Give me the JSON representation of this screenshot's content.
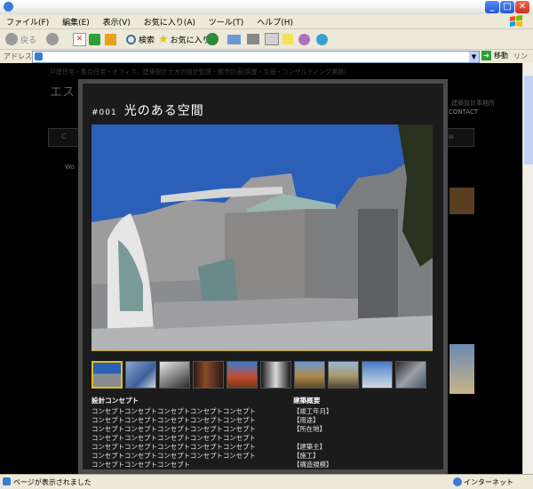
{
  "window": {
    "min_glyph": "_",
    "max_glyph": "□",
    "close_glyph": "✕"
  },
  "menu": [
    "ファイル(F)",
    "編集(E)",
    "表示(V)",
    "お気に入り(A)",
    "ツール(T)",
    "ヘルプ(H)"
  ],
  "toolbar": {
    "back": "戻る",
    "search": "検索",
    "favorites": "お気に入り"
  },
  "addressbar": {
    "label": "アドレス(D)",
    "value": "",
    "go": "移動",
    "links": "リンク"
  },
  "background_page": {
    "tagline": "戸建住宅・集合住宅・オフィス、建築設計士木の設計監理・都市計画(調査・企画・コンサルティング業務)",
    "title": "エス",
    "office": "建築設計事務所",
    "contact": "CONTACT",
    "nav_left": "C",
    "nav_right": "w",
    "sub_left": "Wo"
  },
  "lightbox": {
    "number": "#001",
    "title": "光のある空間",
    "concept_heading": "設計コンセプト",
    "concept_lines": [
      "コンセプトコンセプトコンセプトコンセプトコンセプト",
      "コンセプトコンセプトコンセプトコンセプトコンセプト",
      "コンセプトコンセプトコンセプトコンセプトコンセプト",
      "コンセプトコンセプトコンセプトコンセプトコンセプト",
      "コンセプトコンセプトコンセプトコンセプトコンセプト",
      "コンセプトコンセプトコンセプトコンセプトコンセプト",
      "コンセプトコンセプトコンセプト"
    ],
    "overview_heading": "建築概要",
    "overview_lines_a": [
      "【竣工年月】",
      "【用途】",
      "【所在地】"
    ],
    "overview_lines_b": [
      "【建築主】",
      "【施工】",
      "【構造規模】"
    ]
  },
  "status": {
    "text": "ページが表示されました",
    "zone": "インターネット"
  },
  "colors": {
    "accent": "#d8c21a",
    "sky": "#2e5fbc"
  }
}
